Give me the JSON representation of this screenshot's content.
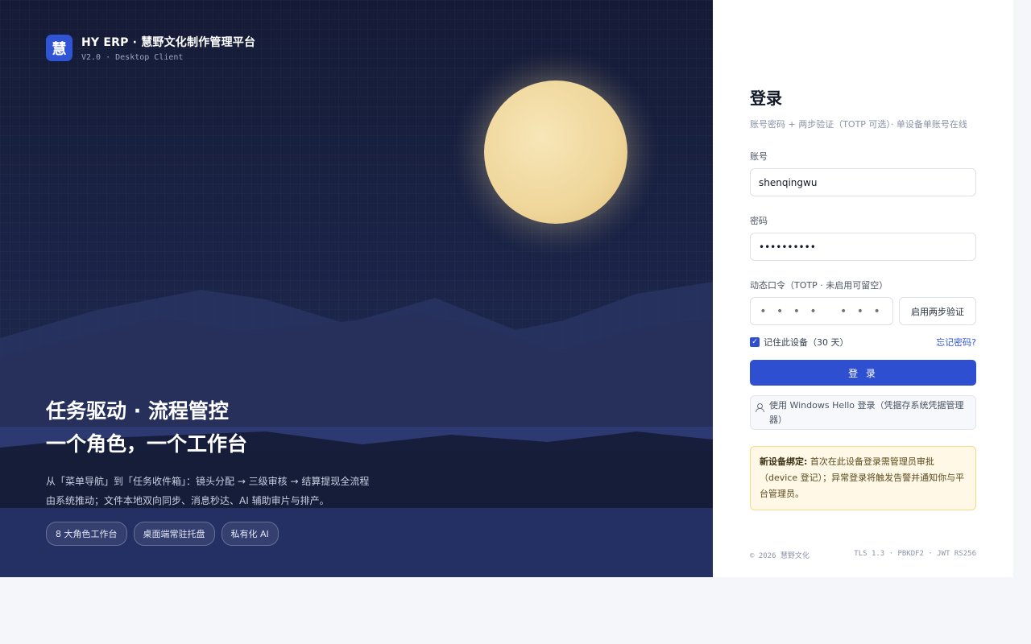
{
  "brand": {
    "logo_char": "慧",
    "title": "HY ERP · 慧野文化制作管理平台",
    "subtitle": "V2.0 · Desktop Client"
  },
  "hero": {
    "headline_line1": "任务驱动 · 流程管控",
    "headline_line2": "一个角色，一个工作台",
    "desc_line1": "从「菜单导航」到「任务收件箱」：镜头分配 → 三级审核 → 结算提现全流程",
    "desc_line2": "由系统推动；文件本地双向同步、消息秒达、AI 辅助审片与排产。",
    "tags": [
      "8 大角色工作台",
      "桌面端常驻托盘",
      "私有化 AI"
    ]
  },
  "login": {
    "title": "登录",
    "subtitle": "账号密码 + 两步验证（TOTP 可选）· 单设备单账号在线",
    "account_label": "账号",
    "account_value": "shenqingwu",
    "password_label": "密码",
    "password_value": "••••••••••",
    "otp_label": "动态口令（TOTP · 未启用可留空）",
    "otp_placeholder": "• • • •   • • •",
    "enable_2fa_label": "启用两步验证",
    "remember_label": "记住此设备（30 天）",
    "remember_checked": true,
    "forgot_label": "忘记密码?",
    "submit_label": "登 录",
    "windows_hello_label": "使用 Windows Hello 登录（凭据存系统凭据管理器）",
    "notice_title": "新设备绑定:",
    "notice_text": "首次在此设备登录需管理员审批（device 登记）；异常登录将触发告警并通知你与平台管理员。"
  },
  "footer": {
    "copyright": "© 2026 慧野文化",
    "security": "TLS 1.3 · PBKDF2 · JWT RS256"
  },
  "colors": {
    "primary": "#2e4fcf",
    "hero_bg": "#1b2447",
    "moon": "#efd69a",
    "notice_bg": "#fff8e6"
  }
}
